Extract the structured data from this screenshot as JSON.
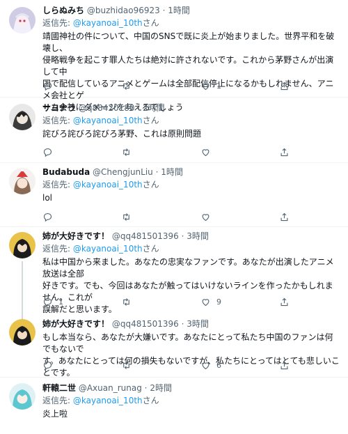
{
  "tweets": [
    {
      "name": "しらぬみち",
      "handle": "@buzhidao96923",
      "time": "1時間",
      "reply_prefix": "返信先:",
      "reply_to": "@kayanoai_10th",
      "reply_suffix": "さん",
      "lines": [
        "靖國神社の件について、中国のSNSで既に炎上が始まりました。世界平和を破壊し、",
        "侵略戦争を起こす罪人たちは絶対に許されないです。これから茅野さんが出演して中",
        "国で配信しているアニメとゲームは全部配信停止になるかもしれません、アニメ会社とゲ",
        "ーム会社にダメージを与えるでしょう"
      ],
      "replies": "",
      "retweets": "",
      "likes": "1"
    },
    {
      "name": "サヨナラ",
      "handle": "@q88420180",
      "time": "2時間",
      "reply_prefix": "返信先:",
      "reply_to": "@kayanoai_10th",
      "reply_suffix": "さん",
      "lines": [
        "詫びろ詫びろ詫びろ茅野、これは原則問題"
      ],
      "replies": "",
      "retweets": "",
      "likes": ""
    },
    {
      "name": "Budabuda",
      "handle": "@ChengjunLiu",
      "time": "1時間",
      "reply_prefix": "返信先:",
      "reply_to": "@kayanoai_10th",
      "reply_suffix": "さん",
      "lines": [
        "lol"
      ],
      "replies": "",
      "retweets": "",
      "likes": ""
    },
    {
      "name": "姉が大好きです！",
      "handle": "@qq481501396",
      "time": "3時間",
      "reply_prefix": "返信先:",
      "reply_to": "@kayanoai_10th",
      "reply_suffix": "さん",
      "lines": [
        "私は中国から来ました。あなたの忠実なファンです。あなたが出演したアニメ放送は全部",
        "好きです。でも、今回はあなたが触ってはいけないラインを作ったかもしれません。これが",
        "誤解だと思います。"
      ],
      "replies": "1",
      "retweets": "",
      "likes": "9"
    },
    {
      "name": "姉が大好きです！",
      "handle": "@qq481501396",
      "time": "3時間",
      "reply_prefix": "",
      "reply_to": "",
      "reply_suffix": "",
      "lines": [
        "もし本当なら、あなたが大嫌いです。あなたにとって私たち中国のファンは何でもないで",
        "す。あなたにとっては何の損失もないですが、私たちにとってはとても悲しいことです。"
      ],
      "replies": "",
      "retweets": "",
      "likes": "6"
    },
    {
      "name": "軒轅二世",
      "handle": "@Axuan_runag",
      "time": "2時間",
      "reply_prefix": "返信先:",
      "reply_to": "@kayanoai_10th",
      "reply_suffix": "さん",
      "lines": [
        "炎上啦"
      ],
      "replies": "",
      "retweets": "",
      "likes": ""
    }
  ],
  "separator": "·",
  "icons": {
    "reply": "reply-icon",
    "retweet": "retweet-icon",
    "like": "heart-icon",
    "share": "share-icon"
  },
  "colors": {
    "accent": "#1d9bf0",
    "secondary": "#536471",
    "divider": "#eff3f4"
  }
}
